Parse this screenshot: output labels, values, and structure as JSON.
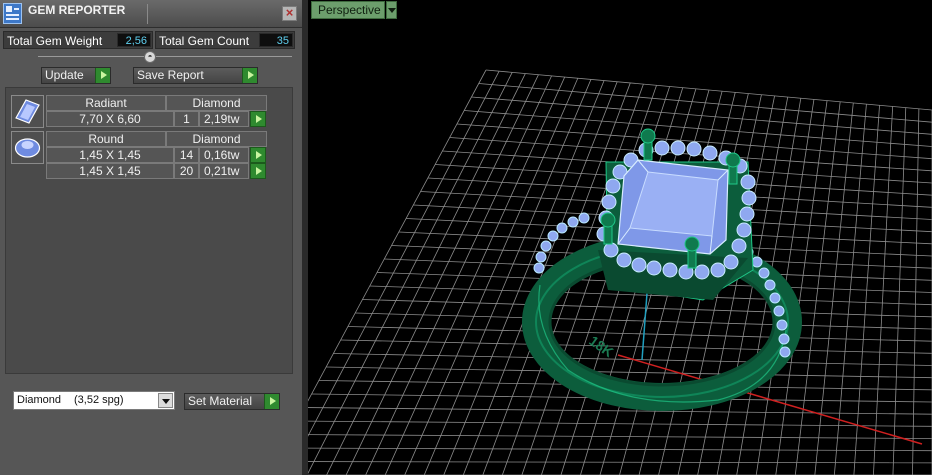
{
  "panel": {
    "title": "GEM REPORTER",
    "close_label": "×",
    "total_weight_label": "Total Gem Weight",
    "total_weight_value": "2,56",
    "total_count_label": "Total Gem Count",
    "total_count_value": "35",
    "splitter_glyph": "◓",
    "update_label": "Update",
    "save_report_label": "Save Report"
  },
  "gems": [
    {
      "cut": "Radiant",
      "material": "Diamond",
      "icon": "radiant-gem-icon",
      "rows": [
        {
          "size": "7,70 X 6,60",
          "count": "1",
          "weight": "2,19tw"
        }
      ]
    },
    {
      "cut": "Round",
      "material": "Diamond",
      "icon": "round-gem-icon",
      "rows": [
        {
          "size": "1,45 X 1,45",
          "count": "14",
          "weight": "0,16tw"
        },
        {
          "size": "1,45 X 1,45",
          "count": "20",
          "weight": "0,21tw"
        }
      ]
    }
  ],
  "material_select": {
    "name": "Diamond",
    "density": "(3,52 spg)"
  },
  "set_material_label": "Set Material",
  "viewport": {
    "view_name": "Perspective",
    "ring_engraving": "18K"
  },
  "colors": {
    "metal": "#0f7a4e",
    "gem": "#8fa8f0",
    "grid": "#8c8c8c",
    "accent": "#2f8a2f"
  }
}
